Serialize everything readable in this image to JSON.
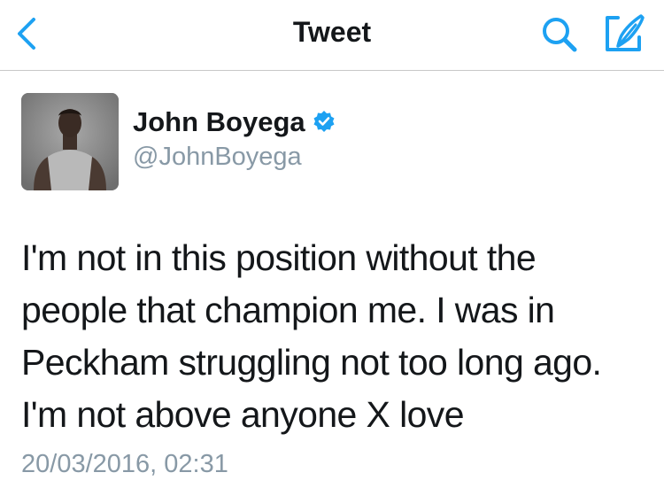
{
  "header": {
    "title": "Tweet",
    "back_icon": "chevron-left-icon",
    "search_icon": "search-icon",
    "compose_icon": "compose-tweet-icon",
    "accent_color": "#1da1f2"
  },
  "tweet": {
    "author_name": "John Boyega",
    "author_handle": "@JohnBoyega",
    "verified": true,
    "text_lines": [
      "I'm not in this position without the",
      "people that champion me. I was in",
      "Peckham struggling not too long ago.",
      "I'm not above anyone X love"
    ],
    "timestamp": "20/03/2016, 02:31"
  }
}
